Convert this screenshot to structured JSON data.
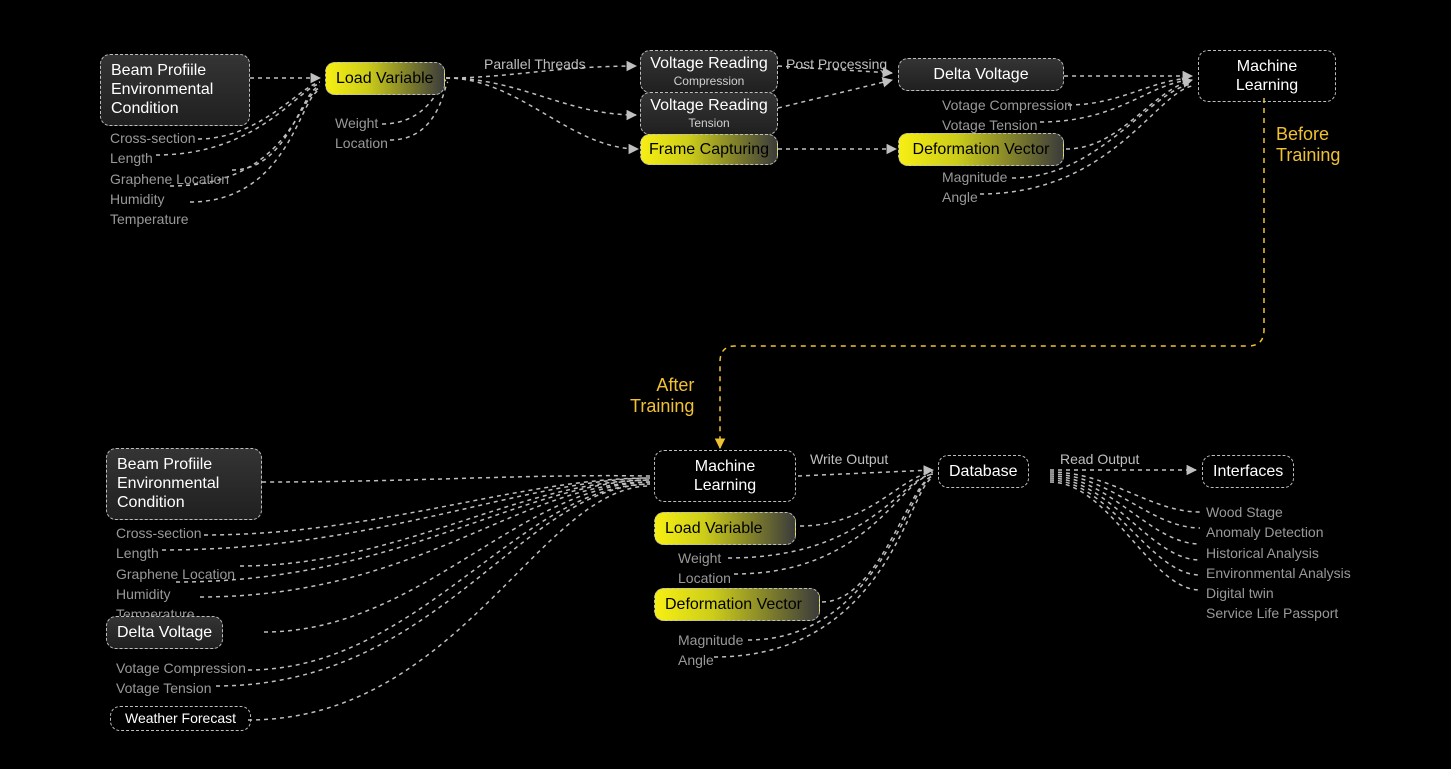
{
  "nodes": {
    "beam1": {
      "t1": "Beam Profiile",
      "t2": "Environmental",
      "t3": "Condition"
    },
    "loadvar": "Load Variable",
    "vrc": {
      "t": "Voltage Reading",
      "s": "Compression"
    },
    "vrt": {
      "t": "Voltage Reading",
      "s": "Tension"
    },
    "frame": "Frame Capturing",
    "delta": "Delta Voltage",
    "defvec": "Deformation Vector",
    "ml1": {
      "t1": "Machine",
      "t2": "Learning"
    },
    "beam2": {
      "t1": "Beam Profiile",
      "t2": "Environmental",
      "t3": "Condition"
    },
    "delta2": "Delta Voltage",
    "weather": "Weather Forecast",
    "ml2": {
      "t1": "Machine",
      "t2": "Learning"
    },
    "loadvar2": "Load Variable",
    "defvec2": "Deformation Vector",
    "db": "Database",
    "ifc": "Interfaces"
  },
  "lists": {
    "beam1_items": [
      "Cross-section",
      "Length",
      "Graphene Location",
      "Humidity",
      "Temperature"
    ],
    "load_items": [
      "Weight",
      "Location"
    ],
    "delta_items": [
      "Votage Compression",
      "Votage Tension"
    ],
    "defvec_items": [
      "Magnitude",
      "Angle"
    ],
    "beam2_items": [
      "Cross-section",
      "Length",
      "Graphene Location",
      "Humidity",
      "Temperature"
    ],
    "delta2_items": [
      "Votage Compression",
      "Votage Tension"
    ],
    "load2_items": [
      "Weight",
      "Location"
    ],
    "defvec2_items": [
      "Magnitude",
      "Angle"
    ],
    "ifc_items": [
      "Wood Stage",
      "Anomaly Detection",
      "Historical Analysis",
      "Environmental Analysis",
      "Digital twin",
      "Service Life Passport"
    ]
  },
  "labels": {
    "parallel": "Parallel Threads",
    "postproc": "Post Processing",
    "before": "Before\nTraining",
    "after": "After\nTraining",
    "writeout": "Write Output",
    "readout": "Read Output"
  }
}
